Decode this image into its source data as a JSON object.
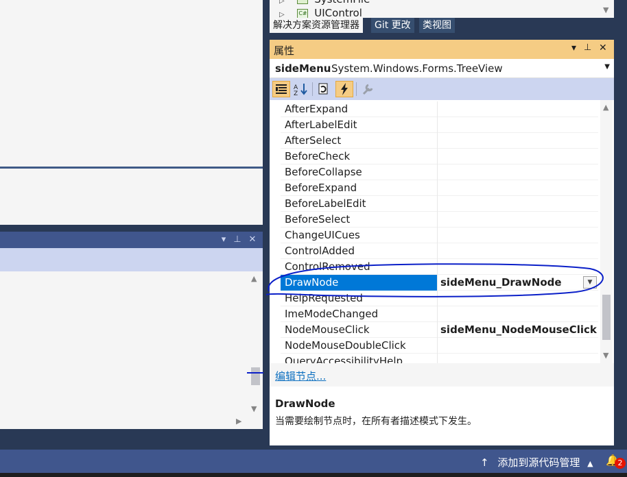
{
  "solution_explorer": {
    "partial_items": [
      {
        "icon": "folder-icon",
        "label": "SystemFile"
      },
      {
        "icon": "csharp-file-icon",
        "label": "UIControl"
      }
    ]
  },
  "dock_tabs": [
    {
      "label": "解决方案资源管理器",
      "active": true
    },
    {
      "label": "Git 更改",
      "active": false
    },
    {
      "label": "类视图",
      "active": false
    }
  ],
  "properties": {
    "title": "属性",
    "title_buttons": {
      "dropdown": "▾",
      "pin": "📌",
      "close": "✕"
    },
    "object_name": "sideMenu",
    "object_type": "System.Windows.Forms.TreeView",
    "toolbar": [
      {
        "icon": "categorized-icon",
        "active": true
      },
      {
        "icon": "alphabetical-sort-icon",
        "active": false
      },
      {
        "icon": "property-pages-icon",
        "active": false
      },
      {
        "icon": "events-lightning-icon",
        "active": true
      },
      {
        "icon": "wrench-icon",
        "active": false
      }
    ],
    "events": [
      {
        "name": "AfterExpand",
        "value": ""
      },
      {
        "name": "AfterLabelEdit",
        "value": ""
      },
      {
        "name": "AfterSelect",
        "value": ""
      },
      {
        "name": "BeforeCheck",
        "value": ""
      },
      {
        "name": "BeforeCollapse",
        "value": ""
      },
      {
        "name": "BeforeExpand",
        "value": ""
      },
      {
        "name": "BeforeLabelEdit",
        "value": ""
      },
      {
        "name": "BeforeSelect",
        "value": ""
      },
      {
        "name": "ChangeUICues",
        "value": ""
      },
      {
        "name": "ControlAdded",
        "value": ""
      },
      {
        "name": "ControlRemoved",
        "value": ""
      },
      {
        "name": "DrawNode",
        "value": "sideMenu_DrawNode",
        "selected": true
      },
      {
        "name": "HelpRequested",
        "value": ""
      },
      {
        "name": "ImeModeChanged",
        "value": ""
      },
      {
        "name": "NodeMouseClick",
        "value": "sideMenu_NodeMouseClick"
      },
      {
        "name": "NodeMouseDoubleClick",
        "value": ""
      },
      {
        "name": "QueryAccessibilityHelp",
        "value": ""
      }
    ],
    "command_link": "编辑节点...",
    "description_name": "DrawNode",
    "description_text": "当需要绘制节点时，在所有者描述模式下发生。"
  },
  "status_bar": {
    "source_control": "添加到源代码管理",
    "notification_count": "2"
  },
  "colors": {
    "chrome": "#293955",
    "title_active": "#f5cc84",
    "selection": "#0078d7",
    "annotation": "#0a1fc8"
  }
}
